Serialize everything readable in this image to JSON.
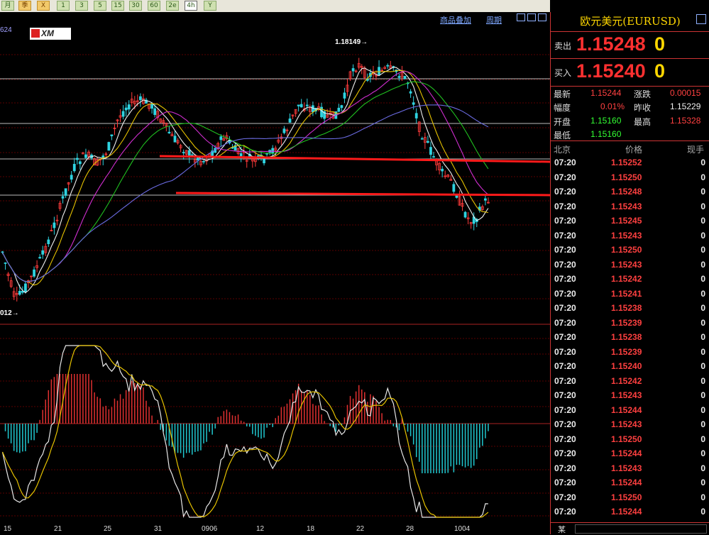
{
  "toolbar": {
    "buttons": [
      "月",
      "季",
      "X",
      "1",
      "3",
      "5",
      "15",
      "30",
      "60",
      "2e",
      "4h",
      "Y"
    ]
  },
  "chart": {
    "left_value": "624",
    "links": {
      "overlay": "商品叠加",
      "period": "周期"
    },
    "logo": "XM",
    "high_label": "1.18149→",
    "low_label": "012→",
    "x_labels": [
      "15",
      "21",
      "25",
      "31",
      "0906",
      "12",
      "18",
      "22",
      "28",
      "1004"
    ]
  },
  "panel": {
    "title": "欧元美元(EURUSD)",
    "sell": {
      "label": "卖出",
      "price": "1.15248",
      "vol": "0"
    },
    "buy": {
      "label": "买入",
      "price": "1.15240",
      "vol": "0"
    },
    "stats": {
      "latest_label": "最新",
      "latest": "1.15244",
      "change_label": "涨跌",
      "change": "0.00015",
      "range_label": "幅度",
      "range": "0.01%",
      "prev_label": "昨收",
      "prev": "1.15229",
      "open_label": "开盘",
      "open": "1.15160",
      "high_label": "最高",
      "high": "1.15328",
      "low_label": "最低",
      "low": "1.15160"
    },
    "tick_header": {
      "time": "北京",
      "price": "价格",
      "vol": "现手"
    },
    "ticks": [
      {
        "time": "07:20",
        "price": "1.15252",
        "vol": "0"
      },
      {
        "time": "07:20",
        "price": "1.15250",
        "vol": "0"
      },
      {
        "time": "07:20",
        "price": "1.15248",
        "vol": "0"
      },
      {
        "time": "07:20",
        "price": "1.15243",
        "vol": "0"
      },
      {
        "time": "07:20",
        "price": "1.15245",
        "vol": "0"
      },
      {
        "time": "07:20",
        "price": "1.15243",
        "vol": "0"
      },
      {
        "time": "07:20",
        "price": "1.15250",
        "vol": "0"
      },
      {
        "time": "07:20",
        "price": "1.15243",
        "vol": "0"
      },
      {
        "time": "07:20",
        "price": "1.15242",
        "vol": "0"
      },
      {
        "time": "07:20",
        "price": "1.15241",
        "vol": "0"
      },
      {
        "time": "07:20",
        "price": "1.15238",
        "vol": "0"
      },
      {
        "time": "07:20",
        "price": "1.15239",
        "vol": "0"
      },
      {
        "time": "07:20",
        "price": "1.15238",
        "vol": "0"
      },
      {
        "time": "07:20",
        "price": "1.15239",
        "vol": "0"
      },
      {
        "time": "07:20",
        "price": "1.15240",
        "vol": "0"
      },
      {
        "time": "07:20",
        "price": "1.15242",
        "vol": "0"
      },
      {
        "time": "07:20",
        "price": "1.15243",
        "vol": "0"
      },
      {
        "time": "07:20",
        "price": "1.15244",
        "vol": "0"
      },
      {
        "time": "07:20",
        "price": "1.15243",
        "vol": "0"
      },
      {
        "time": "07:20",
        "price": "1.15250",
        "vol": "0"
      },
      {
        "time": "07:20",
        "price": "1.15244",
        "vol": "0"
      },
      {
        "time": "07:20",
        "price": "1.15243",
        "vol": "0"
      },
      {
        "time": "07:20",
        "price": "1.15244",
        "vol": "0"
      },
      {
        "time": "07:20",
        "price": "1.15250",
        "vol": "0"
      },
      {
        "time": "07:20",
        "price": "1.15244",
        "vol": "0"
      }
    ],
    "bottom_label": "某"
  },
  "colors": {
    "up": "#ff3b3b",
    "down": "#2fd3e0",
    "accent": "#ffd700"
  }
}
